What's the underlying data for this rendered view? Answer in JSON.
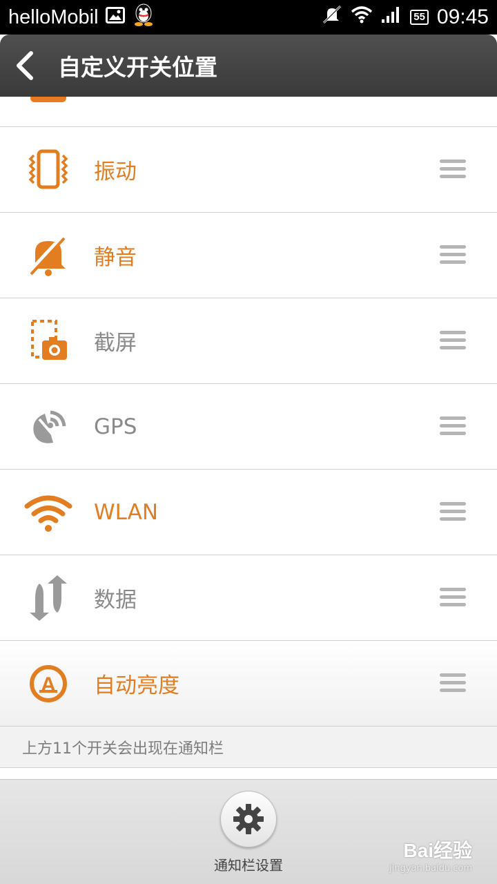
{
  "status_bar": {
    "carrier": "helloMobil",
    "time": "09:45",
    "battery": "55"
  },
  "header": {
    "title": "自定义开关位置"
  },
  "list": {
    "items": [
      {
        "label": "振动",
        "state": "on",
        "icon": "vibrate-icon"
      },
      {
        "label": "静音",
        "state": "on",
        "icon": "mute-bell-icon"
      },
      {
        "label": "截屏",
        "state": "off",
        "icon": "screenshot-icon"
      },
      {
        "label": "GPS",
        "state": "off",
        "icon": "gps-icon"
      },
      {
        "label": "WLAN",
        "state": "on",
        "icon": "wifi-icon"
      },
      {
        "label": "数据",
        "state": "off",
        "icon": "data-sync-icon"
      },
      {
        "label": "自动亮度",
        "state": "on",
        "icon": "auto-brightness-icon"
      }
    ]
  },
  "note": "上方11个开关会出现在通知栏",
  "bottom": {
    "settings_label": "通知栏设置"
  },
  "watermark": {
    "logo": "Bai经验",
    "url": "jingyan.baidu.com"
  },
  "colors": {
    "accent": "#e37d21",
    "inactive": "#8a8a8a"
  }
}
